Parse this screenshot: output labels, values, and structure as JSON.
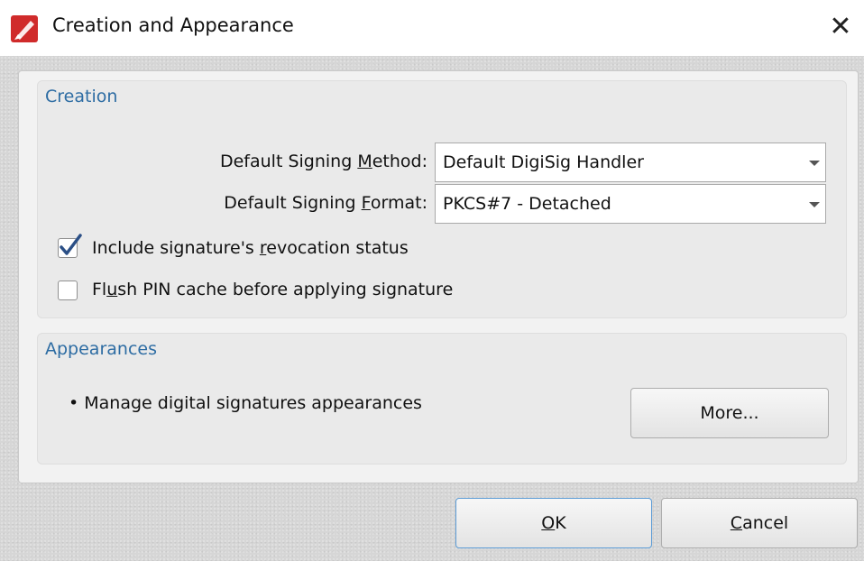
{
  "window": {
    "title": "Creation and Appearance",
    "close_glyph": "✕",
    "icon": "pdf-editor-icon"
  },
  "creation": {
    "header": "Creation",
    "method": {
      "label_before": "Default Signing ",
      "label_underlined": "M",
      "label_after": "ethod:",
      "value": "Default DigiSig Handler"
    },
    "format": {
      "label_before": "Default Signing ",
      "label_underlined": "F",
      "label_after": "ormat:",
      "value": "PKCS#7 - Detached"
    },
    "revocation": {
      "checked": true,
      "label_before": "Include signature's ",
      "label_underlined": "r",
      "label_after": "evocation status"
    },
    "flush": {
      "checked": false,
      "label_before": "Fl",
      "label_underlined": "u",
      "label_after": "sh PIN cache before applying signature"
    }
  },
  "appearances": {
    "header": "Appearances",
    "bullet": "• Manage digital signatures appearances",
    "more_label": "More..."
  },
  "footer": {
    "ok_underlined": "O",
    "ok_rest": "K",
    "cancel_underlined": "C",
    "cancel_rest": "ancel"
  },
  "colors": {
    "header_blue": "#2d6ca3",
    "icon_red": "#d02b2b"
  }
}
